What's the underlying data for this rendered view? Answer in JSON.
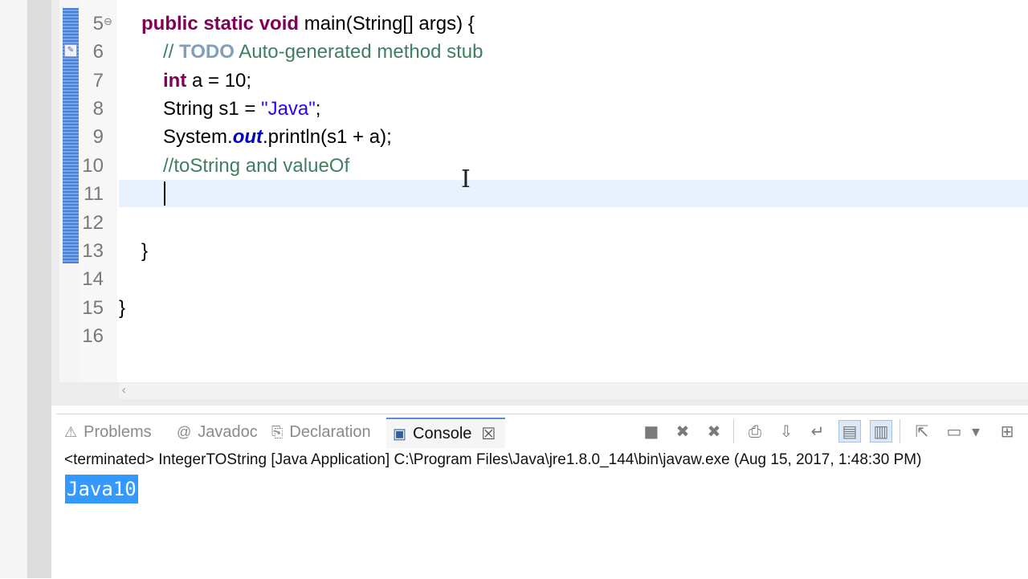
{
  "editor": {
    "lines": [
      {
        "num": "5",
        "tokens": [
          {
            "t": "public static void ",
            "c": "kw"
          },
          {
            "t": "main(String[] ",
            "c": ""
          },
          {
            "t": "args",
            "c": "var"
          },
          {
            "t": ") {",
            "c": ""
          }
        ]
      },
      {
        "num": "6",
        "tokens": [
          {
            "t": "// ",
            "c": "cm"
          },
          {
            "t": "TODO",
            "c": "todo"
          },
          {
            "t": " Auto-generated method stub",
            "c": "cm"
          }
        ]
      },
      {
        "num": "7",
        "tokens": [
          {
            "t": "int",
            "c": "kw"
          },
          {
            "t": " a = 10;",
            "c": ""
          }
        ]
      },
      {
        "num": "8",
        "tokens": [
          {
            "t": "String s1 = ",
            "c": ""
          },
          {
            "t": "\"Java\"",
            "c": "str"
          },
          {
            "t": ";",
            "c": ""
          }
        ]
      },
      {
        "num": "9",
        "tokens": [
          {
            "t": "System.",
            "c": ""
          },
          {
            "t": "out",
            "c": "fld"
          },
          {
            "t": ".println(s1 + a);",
            "c": ""
          }
        ]
      },
      {
        "num": "10",
        "tokens": [
          {
            "t": "//toString and valueOf",
            "c": "cm"
          }
        ]
      },
      {
        "num": "11",
        "tokens": []
      },
      {
        "num": "12",
        "tokens": []
      },
      {
        "num": "13",
        "tokens": [
          {
            "t": "}",
            "c": ""
          }
        ]
      },
      {
        "num": "14",
        "tokens": []
      },
      {
        "num": "15",
        "tokens": [
          {
            "t": "}",
            "c": ""
          }
        ]
      },
      {
        "num": "16",
        "tokens": []
      }
    ]
  },
  "views": {
    "tabs": [
      {
        "label": "Problems",
        "icon": "problems-icon"
      },
      {
        "label": "Javadoc",
        "icon": "at-icon"
      },
      {
        "label": "Declaration",
        "icon": "declaration-icon"
      },
      {
        "label": "Console",
        "icon": "console-icon",
        "active": true
      }
    ]
  },
  "console": {
    "status": "<terminated> IntegerTOString [Java Application] C:\\Program Files\\Java\\jre1.8.0_144\\bin\\javaw.exe (Aug 15, 2017, 1:48:30 PM)",
    "output": "Java10"
  },
  "colors": {
    "keyword": "#7f0055",
    "comment": "#3f7f5f",
    "todo": "#7f9fbf",
    "string": "#2a00ff",
    "field": "#0000c0",
    "selection": "#3399ff",
    "current_line": "#e8f2fe"
  }
}
